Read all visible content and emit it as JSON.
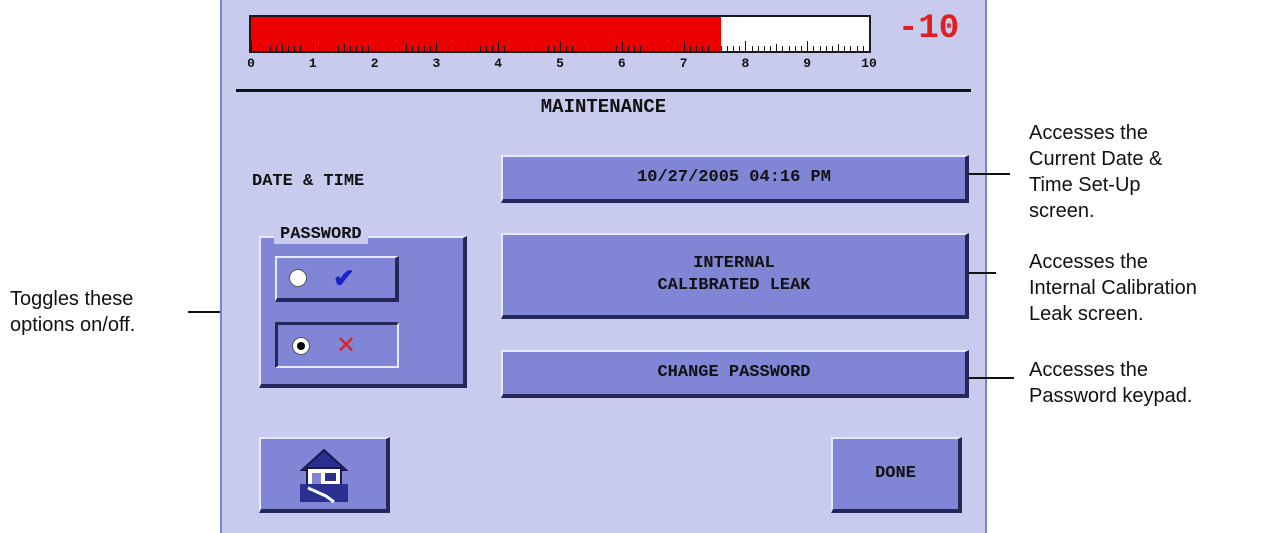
{
  "gauge": {
    "fill_fraction": 0.76,
    "scale_labels": [
      "0",
      "1",
      "2",
      "3",
      "4",
      "5",
      "6",
      "7",
      "8",
      "9",
      "10"
    ],
    "readout": "-10",
    "fill_color": "#ee0000"
  },
  "screen": {
    "title": "MAINTENANCE"
  },
  "date_time": {
    "label": "DATE & TIME",
    "value": "10/27/2005 04:16 PM"
  },
  "internal_leak": {
    "line1": "INTERNAL",
    "line2": "CALIBRATED LEAK"
  },
  "password": {
    "label": "PASSWORD",
    "options": [
      {
        "mark": "✔",
        "selected": false,
        "icon": "check-icon"
      },
      {
        "mark": "✕",
        "selected": true,
        "icon": "cross-icon"
      }
    ]
  },
  "change_password": {
    "label": "CHANGE PASSWORD"
  },
  "done": {
    "label": "DONE"
  },
  "home": {
    "icon": "home-icon"
  },
  "callouts": {
    "date": [
      "Accesses the",
      "Current Date &",
      "Time Set-Up",
      "screen."
    ],
    "leak": [
      "Accesses the",
      "Internal Calibration",
      "Leak screen."
    ],
    "password": [
      "Accesses the",
      "Password keypad."
    ],
    "toggle": [
      "Toggles these",
      "options on/off."
    ]
  }
}
